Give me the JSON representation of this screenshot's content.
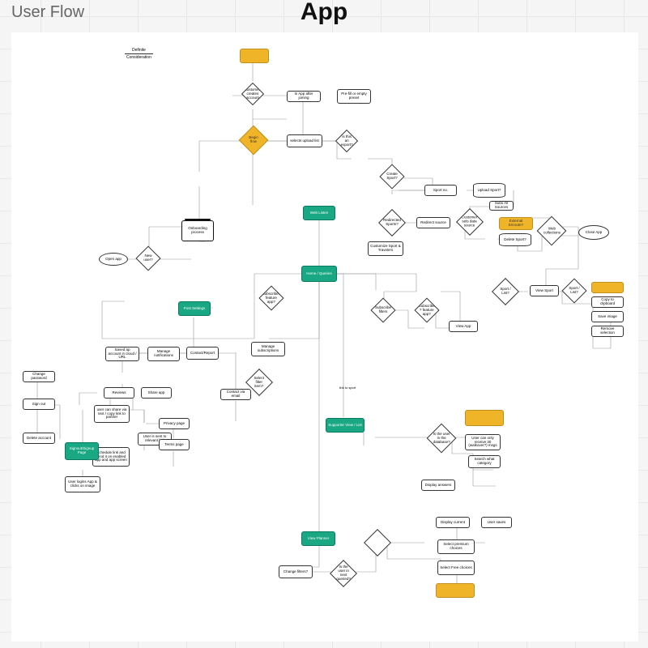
{
  "header": "User Flow",
  "title": "App",
  "legend": {
    "definition": "Definite",
    "consideration": "Consideration"
  },
  "nodes": {
    "onboarding_frame": "Onboarding process",
    "open_app": "Open app",
    "new_user": "New user?",
    "n1": "",
    "n2": "customer creates account",
    "n3": "In App after joining",
    "n4": "Pre-fill or empty preset",
    "n5": "Begin flow",
    "n6": "selects upload list",
    "n7": "is this an export?",
    "n8": "Create Sport?",
    "n9": "Sport no.",
    "n10": "Upload Sport?",
    "n11": "Redirected Sports?",
    "n12": "Redirect source",
    "n13": "Customer sets data source",
    "n14": "External Enroute?",
    "n15": "Subs All Sources",
    "n16": "Delete Sport?",
    "n17": "Web collections",
    "n18": "Close App",
    "n19": "Web Listen",
    "home_queries": "Home / Queries",
    "n20": "Customize Sport & Travelers",
    "n21": "Subscribe? feature app?",
    "post_settings": "Post Settings",
    "n22": "Subscribe filters",
    "n23": "Subscribe ? feature app?",
    "n24": "View App",
    "n25": "Sport / List?",
    "n26": "View Sport",
    "n27": "",
    "n28": "Copy to clipboard",
    "n29": "Save image",
    "n30": "Remove selection",
    "n31": "Saved ap account in cloud / URL",
    "n32": "Manage notifications",
    "n33": "Contact/Report",
    "n34": "Manage subscriptions",
    "n35": "Select filter item?",
    "n36": "link to sport",
    "n37": "Change password",
    "n38": "Sign out",
    "n39": "Delete account",
    "n40": "Reviews",
    "n41": "Share app",
    "n42": "user can share via text / copy link to partner",
    "n43": "User is sent to relevant link",
    "n44": "Schedule link and send it on enabled app and app screen",
    "n45": "Privacy page",
    "n46": "Terms page",
    "n47": "Contact via email",
    "sign_page": "Signout/Signup Page",
    "n48": "User logins App & clicks on image",
    "supporter_view": "Supporter View / List",
    "n49": "",
    "n50": "Is the user in the database?",
    "n51": "User can only receive 30 (walkover?) msgs",
    "n52": "Search what category",
    "n53": "Display answers",
    "view_planner": "View Planner",
    "n54": "Change filters?",
    "n55": "Is the user in next queried?",
    "n56": "Display current",
    "n57": "User saves",
    "n58": "Select premium choices",
    "n59": "Select Free choices",
    "n60": ""
  }
}
